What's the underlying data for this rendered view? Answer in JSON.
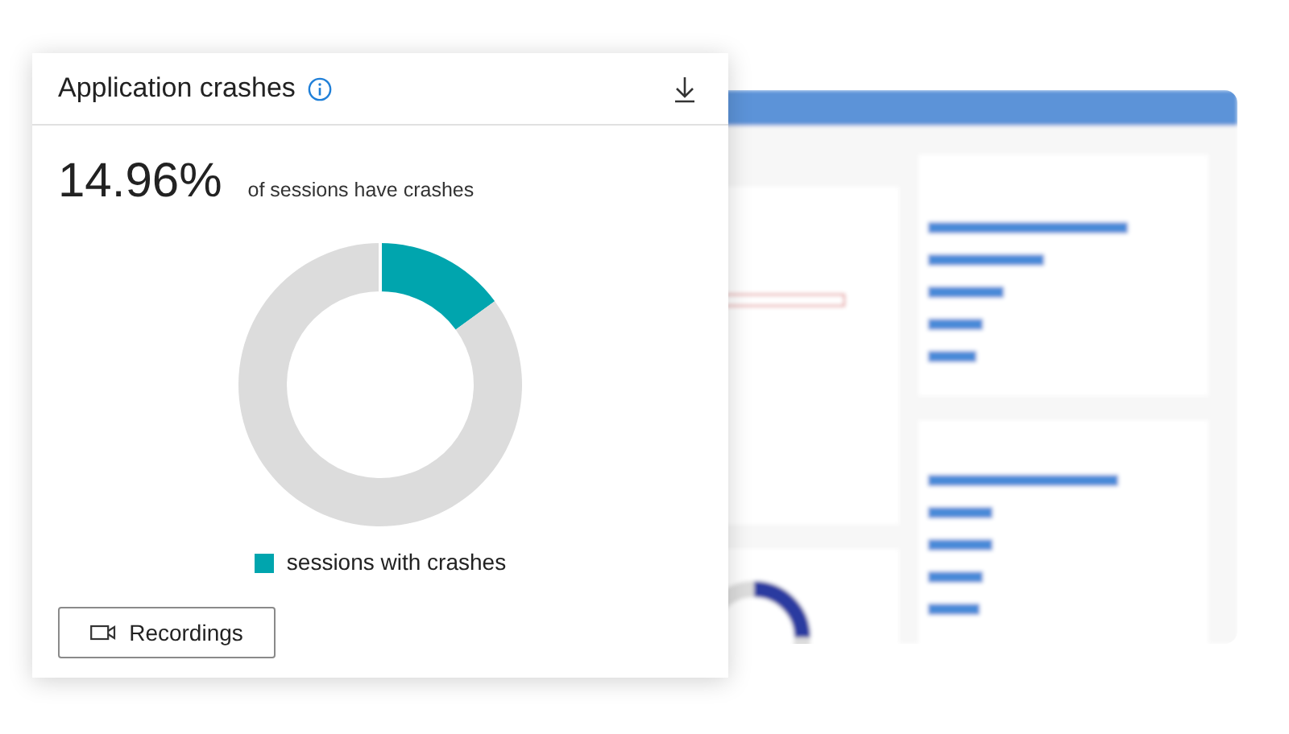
{
  "card": {
    "title": "Application crashes",
    "value": "14.96%",
    "caption": "of sessions have crashes",
    "chart_data": {
      "type": "donut",
      "values": [
        14.96,
        85.04
      ],
      "colors": [
        "#00a5ae",
        "#dcdcdc"
      ]
    },
    "legend": [
      {
        "label": "sessions with crashes",
        "color": "#00a5ae"
      }
    ],
    "button": "Recordings"
  }
}
